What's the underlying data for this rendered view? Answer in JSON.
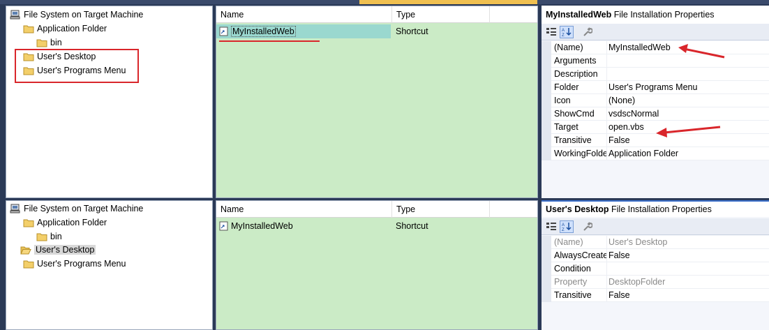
{
  "colors": {
    "accent_red": "#d9262b",
    "list_bg": "#cbebc6",
    "selection": "#9ad8cf"
  },
  "top": {
    "tree": {
      "root": "File System on Target Machine",
      "items": [
        {
          "label": "Application Folder",
          "icon": "folder-icon"
        },
        {
          "label": "bin",
          "icon": "folder-icon"
        },
        {
          "label": "User's Desktop",
          "icon": "folder-icon"
        },
        {
          "label": "User's Programs Menu",
          "icon": "folder-icon"
        }
      ]
    },
    "list": {
      "columns": [
        "Name",
        "Type"
      ],
      "rows": [
        {
          "name": "MyInstalledWeb",
          "type": "Shortcut"
        }
      ]
    },
    "props": {
      "title_bold": "MyInstalledWeb",
      "title_rest": "File Installation Properties",
      "rows": [
        {
          "key": "(Name)",
          "value": "MyInstalledWeb"
        },
        {
          "key": "Arguments",
          "value": ""
        },
        {
          "key": "Description",
          "value": ""
        },
        {
          "key": "Folder",
          "value": "User's Programs Menu"
        },
        {
          "key": "Icon",
          "value": "(None)"
        },
        {
          "key": "ShowCmd",
          "value": "vsdscNormal"
        },
        {
          "key": "Target",
          "value": "open.vbs"
        },
        {
          "key": "Transitive",
          "value": "False"
        },
        {
          "key": "WorkingFolder",
          "value": "Application Folder"
        }
      ]
    }
  },
  "bottom": {
    "tree": {
      "root": "File System on Target Machine",
      "items": [
        {
          "label": "Application Folder",
          "icon": "folder-icon"
        },
        {
          "label": "bin",
          "icon": "folder-icon"
        },
        {
          "label": "User's Desktop",
          "icon": "folder-icon"
        },
        {
          "label": "User's Programs Menu",
          "icon": "folder-icon"
        }
      ]
    },
    "list": {
      "columns": [
        "Name",
        "Type"
      ],
      "rows": [
        {
          "name": "MyInstalledWeb",
          "type": "Shortcut"
        }
      ]
    },
    "props": {
      "title_bold": "User's Desktop",
      "title_rest": "File Installation Properties",
      "rows": [
        {
          "key": "(Name)",
          "value": "User's Desktop"
        },
        {
          "key": "AlwaysCreate",
          "value": "False"
        },
        {
          "key": "Condition",
          "value": ""
        },
        {
          "key": "Property",
          "value": "DesktopFolder"
        },
        {
          "key": "Transitive",
          "value": "False"
        }
      ]
    }
  }
}
